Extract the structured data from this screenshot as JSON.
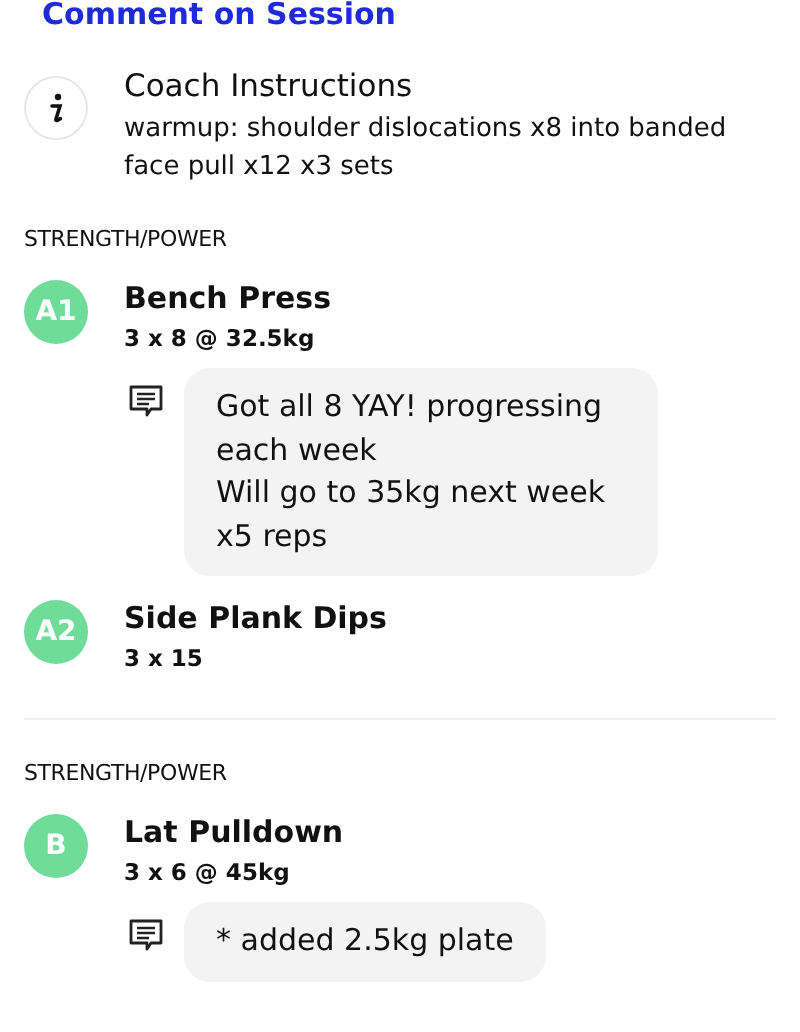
{
  "header": {
    "link": "Comment on Session"
  },
  "coach": {
    "title": "Coach Instructions",
    "text": "warmup: shoulder dislocations x8 into banded face pull x12 x3 sets"
  },
  "sections": [
    {
      "label": "STRENGTH/POWER",
      "exercises": [
        {
          "badge": "A1",
          "name": "Bench Press",
          "prescription": "3 x 8 @ 32.5kg",
          "comment": "Got all 8 YAY! progressing each week\nWill go to 35kg next week x5 reps"
        },
        {
          "badge": "A2",
          "name": "Side Plank Dips",
          "prescription": "3 x 15"
        }
      ]
    },
    {
      "label": "STRENGTH/POWER",
      "exercises": [
        {
          "badge": "B",
          "name": "Lat Pulldown",
          "prescription": "3 x 6 @ 45kg",
          "comment": "* added 2.5kg plate"
        }
      ]
    }
  ]
}
